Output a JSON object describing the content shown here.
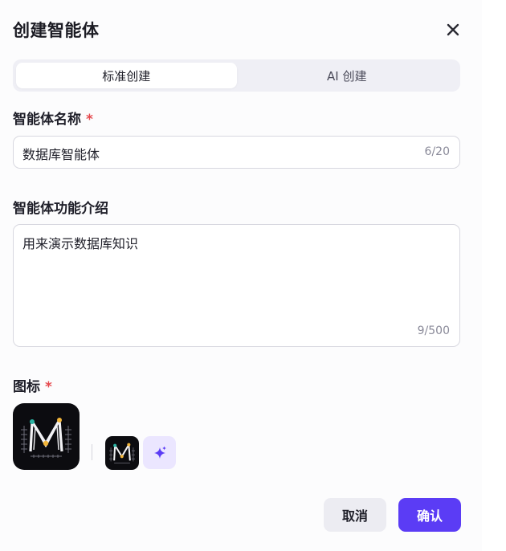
{
  "dialog": {
    "title": "创建智能体"
  },
  "tabs": [
    {
      "label": "标准创建",
      "active": true
    },
    {
      "label": "AI 创建",
      "active": false
    }
  ],
  "name_field": {
    "label": "智能体名称",
    "required_mark": "*",
    "value": "数据库智能体",
    "counter": "6/20"
  },
  "desc_field": {
    "label": "智能体功能介绍",
    "value": "用来演示数据库知识",
    "counter": "9/500"
  },
  "icon_field": {
    "label": "图标",
    "required_mark": "*"
  },
  "footer": {
    "cancel_label": "取消",
    "confirm_label": "确认"
  },
  "colors": {
    "accent": "#5b3cf5",
    "required": "#e5484d",
    "ai_button_bg": "#ebe6ff"
  },
  "icons": [
    "close-icon",
    "sparkle-icon",
    "agent-logo-icon"
  ]
}
